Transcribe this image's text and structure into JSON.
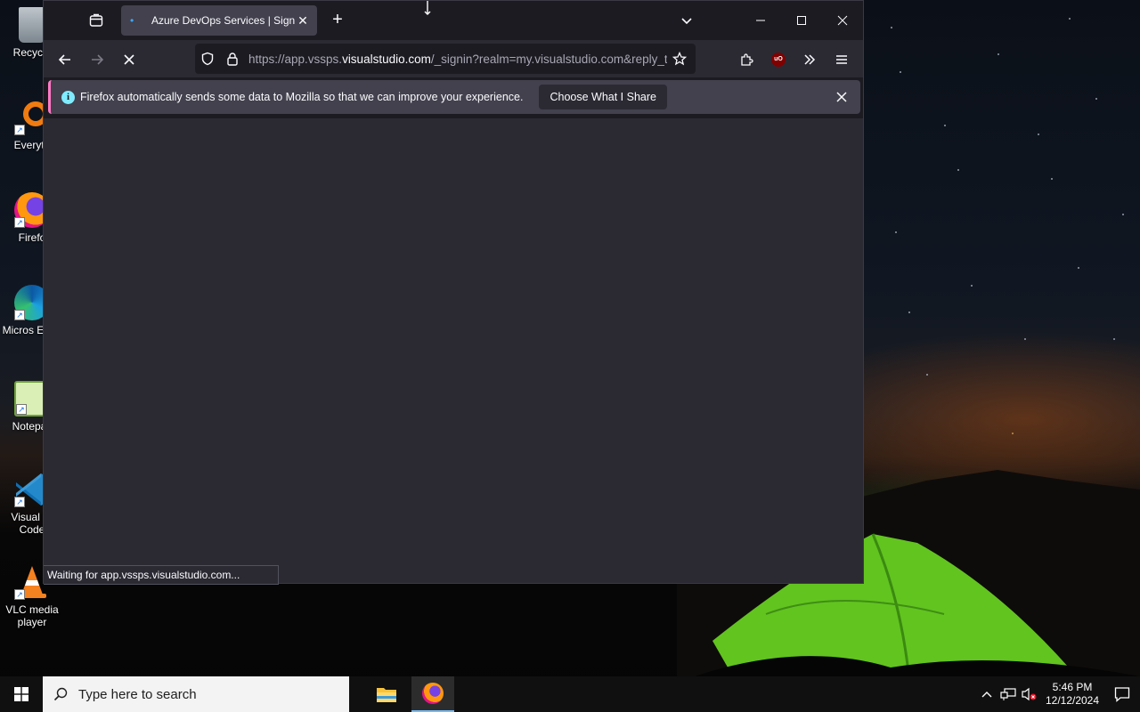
{
  "desktop": {
    "icons": [
      {
        "label": "Recycle"
      },
      {
        "label": "Everyth"
      },
      {
        "label": "Firefo"
      },
      {
        "label": "Micros Edge"
      },
      {
        "label": "Notepac"
      },
      {
        "label": "Visual St Code"
      },
      {
        "label": "VLC media player"
      }
    ]
  },
  "browser": {
    "tab": {
      "title": "Azure DevOps Services | Sign In"
    },
    "url": {
      "prefix": "https://app.vssps.",
      "domain": "visualstudio.com",
      "path": "/_signin?realm=my.visualstudio.com&reply_to="
    },
    "notification": {
      "message": "Firefox automatically sends some data to Mozilla so that we can improve your experience.",
      "cta": "Choose What I Share"
    },
    "status": "Waiting for app.vssps.visualstudio.com..."
  },
  "taskbar": {
    "search_placeholder": "Type here to search",
    "time": "5:46 PM",
    "date": "12/12/2024"
  },
  "colors": {
    "accent_pink": "#ff7ac6",
    "info_blue": "#80ebff",
    "chrome_dark": "#1c1b22",
    "content_bg": "#2b2a33"
  }
}
